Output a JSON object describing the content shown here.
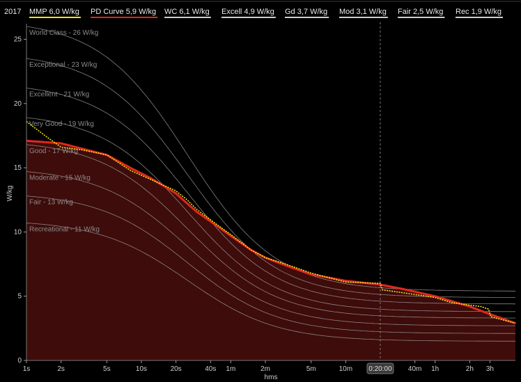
{
  "chart_data": {
    "type": "line",
    "year_label": "2017",
    "xlabel": "hms",
    "ylabel": "W/kg",
    "ylim": [
      0,
      26
    ],
    "x_scale": "log",
    "x_range_seconds": [
      1,
      18000
    ],
    "x_ticks": [
      {
        "label": "1s",
        "seconds": 1
      },
      {
        "label": "2s",
        "seconds": 2
      },
      {
        "label": "5s",
        "seconds": 5
      },
      {
        "label": "10s",
        "seconds": 10
      },
      {
        "label": "20s",
        "seconds": 20
      },
      {
        "label": "40s",
        "seconds": 40
      },
      {
        "label": "1m",
        "seconds": 60
      },
      {
        "label": "2m",
        "seconds": 120
      },
      {
        "label": "5m",
        "seconds": 300
      },
      {
        "label": "10m",
        "seconds": 600
      },
      {
        "label": "40m",
        "seconds": 2400
      },
      {
        "label": "1h",
        "seconds": 3600
      },
      {
        "label": "2h",
        "seconds": 7200
      },
      {
        "label": "3h",
        "seconds": 10800
      }
    ],
    "y_ticks": [
      0,
      5,
      10,
      15,
      20,
      25
    ],
    "cursor": {
      "label": "0:20:00",
      "seconds": 1200
    },
    "legend": [
      {
        "name": "MMP",
        "value": "6,0 W/kg",
        "color": "#f2e21c"
      },
      {
        "name": "PD Curve",
        "value": "5,9 W/kg",
        "color": "#e0281e"
      },
      {
        "name": "WC",
        "value": "6,1 W/kg",
        "color": "#cccccc"
      },
      {
        "name": "Excell",
        "value": "4,9 W/kg",
        "color": "#cccccc"
      },
      {
        "name": "Gd",
        "value": "3,7 W/kg",
        "color": "#cccccc"
      },
      {
        "name": "Mod",
        "value": "3,1 W/kg",
        "color": "#cccccc"
      },
      {
        "name": "Fair",
        "value": "2,5 W/kg",
        "color": "#cccccc"
      },
      {
        "name": "Rec",
        "value": "1,9 W/kg",
        "color": "#cccccc"
      }
    ],
    "bands": [
      {
        "label": "World Class - 26 W/kg",
        "y_start": 26.0,
        "y_end": 5.4
      },
      {
        "label": "Exceptional - 23 W/kg",
        "y_start": 23.5,
        "y_end": 4.9
      },
      {
        "label": "Excellent - 21 W/kg",
        "y_start": 21.2,
        "y_end": 4.4
      },
      {
        "label": "Very Good - 19 W/kg",
        "y_start": 18.9,
        "y_end": 3.8
      },
      {
        "label": "Good - 17 W/kg",
        "y_start": 16.8,
        "y_end": 3.3
      },
      {
        "label": "Moderate - 15 W/kg",
        "y_start": 14.7,
        "y_end": 2.7
      },
      {
        "label": "Fair - 13 W/kg",
        "y_start": 12.8,
        "y_end": 2.1
      },
      {
        "label": "Recreational - 11 W/kg",
        "y_start": 10.7,
        "y_end": 1.5
      }
    ],
    "series": [
      {
        "name": "PD Curve",
        "color": "#e0281e",
        "x": [
          1,
          2,
          3,
          5,
          8,
          12,
          20,
          30,
          45,
          60,
          90,
          120,
          180,
          300,
          600,
          1200,
          1800,
          3600,
          7200,
          10800,
          18000
        ],
        "y": [
          17.1,
          16.9,
          16.5,
          16.0,
          15.0,
          14.2,
          13.0,
          11.6,
          10.5,
          9.7,
          8.6,
          8.0,
          7.4,
          6.7,
          6.2,
          5.9,
          5.6,
          5.0,
          4.2,
          3.6,
          2.9
        ]
      },
      {
        "name": "MMP",
        "color": "#f2e21c",
        "x": [
          1,
          1.5,
          2,
          3,
          5,
          8,
          12,
          20,
          25,
          30,
          45,
          60,
          90,
          120,
          180,
          300,
          600,
          1200,
          1250,
          1800,
          3600,
          5000,
          7200,
          9000,
          10500,
          11000,
          18000
        ],
        "y": [
          18.6,
          17.4,
          16.6,
          16.4,
          16.0,
          14.8,
          14.1,
          13.2,
          12.5,
          11.8,
          10.6,
          9.8,
          8.6,
          8.0,
          7.5,
          6.8,
          6.1,
          6.0,
          5.5,
          5.3,
          4.9,
          4.5,
          4.3,
          4.2,
          4.0,
          3.4,
          2.9
        ]
      }
    ]
  }
}
